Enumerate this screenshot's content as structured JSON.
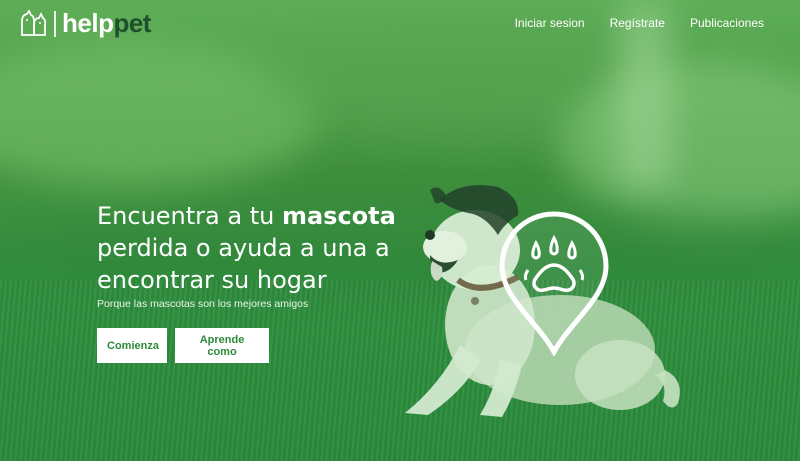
{
  "brand": {
    "name_part1": "help",
    "name_part2": "pet"
  },
  "nav": {
    "items": [
      {
        "label": "Iniciar sesion"
      },
      {
        "label": "Regístrate"
      },
      {
        "label": "Publicaciones"
      }
    ]
  },
  "hero": {
    "headline_prefix": "Encuentra a tu ",
    "headline_bold": "mascota",
    "headline_line2": "perdida o ayuda a una a",
    "headline_line3": "encontrar su hogar",
    "subtitle": "Porque las mascotas son los mejores amigos",
    "primary_button": "Comienza",
    "secondary_button": "Aprende como"
  },
  "colors": {
    "overlay_green": "#3c9443",
    "button_text": "#2c8a3a",
    "logo_dark": "#1f4f2b"
  },
  "icons": [
    "dog-cat-logo-icon",
    "map-pin-paw-icon"
  ]
}
